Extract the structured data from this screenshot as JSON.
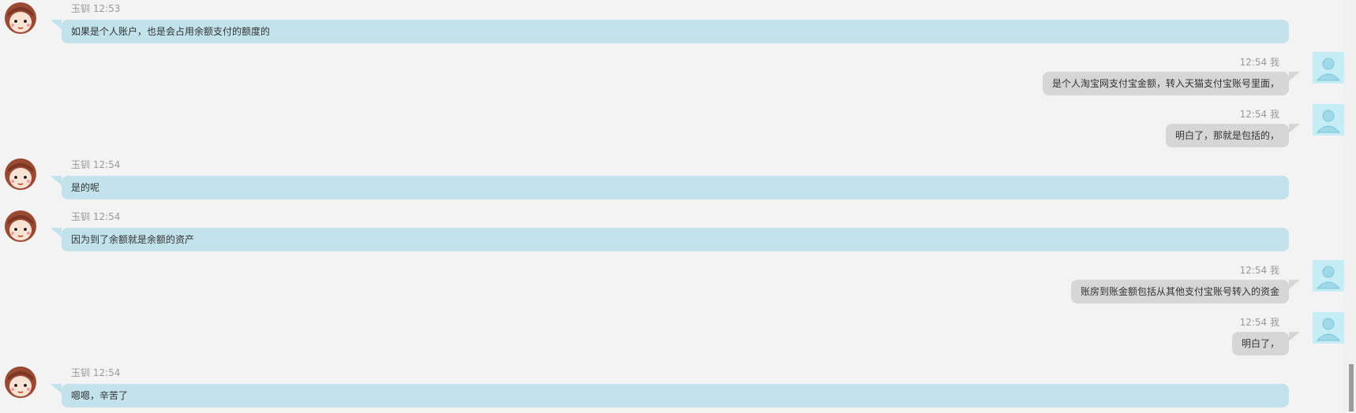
{
  "conversation": {
    "messages": [
      {
        "side": "left",
        "sender": "玉钏",
        "time": "12:53",
        "text": "如果是个人账户，也是会占用余额支付的额度的"
      },
      {
        "side": "right",
        "sender": "我",
        "time": "12:54",
        "text": "是个人淘宝网支付宝金额，转入天猫支付宝账号里面，"
      },
      {
        "side": "right",
        "sender": "我",
        "time": "12:54",
        "text": "明白了，那就是包括的，"
      },
      {
        "side": "left",
        "sender": "玉钏",
        "time": "12:54",
        "text": "是的呢"
      },
      {
        "side": "left",
        "sender": "玉钏",
        "time": "12:54",
        "text": "因为到了余额就是余额的资产"
      },
      {
        "side": "right",
        "sender": "我",
        "time": "12:54",
        "text": "账房到账金额包括从其他支付宝账号转入的资金"
      },
      {
        "side": "right",
        "sender": "我",
        "time": "12:54",
        "text": "明白了，"
      },
      {
        "side": "left",
        "sender": "玉钏",
        "time": "12:54",
        "text": "嗯嗯，辛苦了"
      }
    ]
  },
  "icons": {
    "agent_avatar": "cartoon-girl-avatar-icon",
    "self_avatar": "default-user-avatar-icon"
  },
  "colors": {
    "background": "#f3f3f3",
    "agent_bubble": "#c2e2ec",
    "self_bubble": "#d6d6d6",
    "meta_text": "#999999"
  }
}
